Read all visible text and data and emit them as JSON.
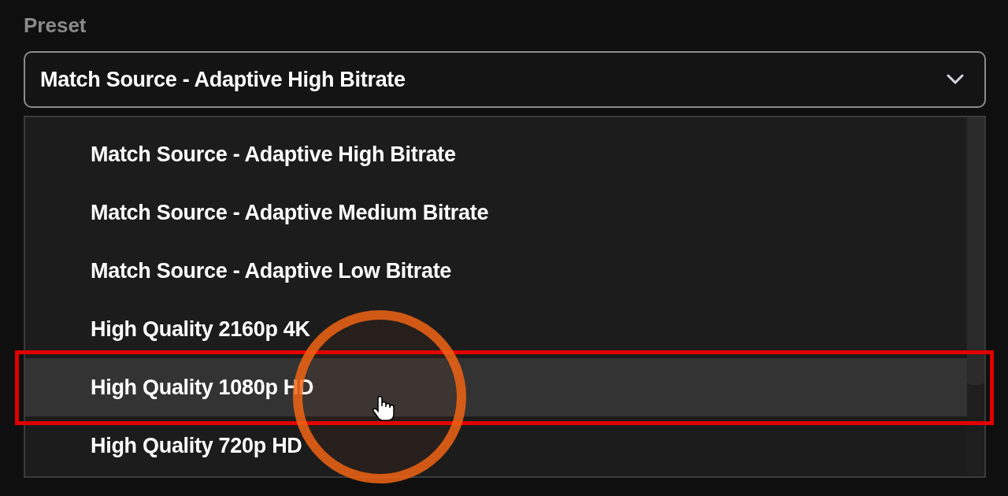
{
  "field": {
    "label": "Preset",
    "value": "Match Source - Adaptive High Bitrate"
  },
  "options": [
    {
      "label": "Match Source - Adaptive High Bitrate",
      "highlighted": false
    },
    {
      "label": "Match Source - Adaptive Medium Bitrate",
      "highlighted": false
    },
    {
      "label": "Match Source - Adaptive Low Bitrate",
      "highlighted": false
    },
    {
      "label": "High Quality 2160p 4K",
      "highlighted": false
    },
    {
      "label": "High Quality 1080p HD",
      "highlighted": true
    },
    {
      "label": "High Quality 720p HD",
      "highlighted": false
    }
  ]
}
